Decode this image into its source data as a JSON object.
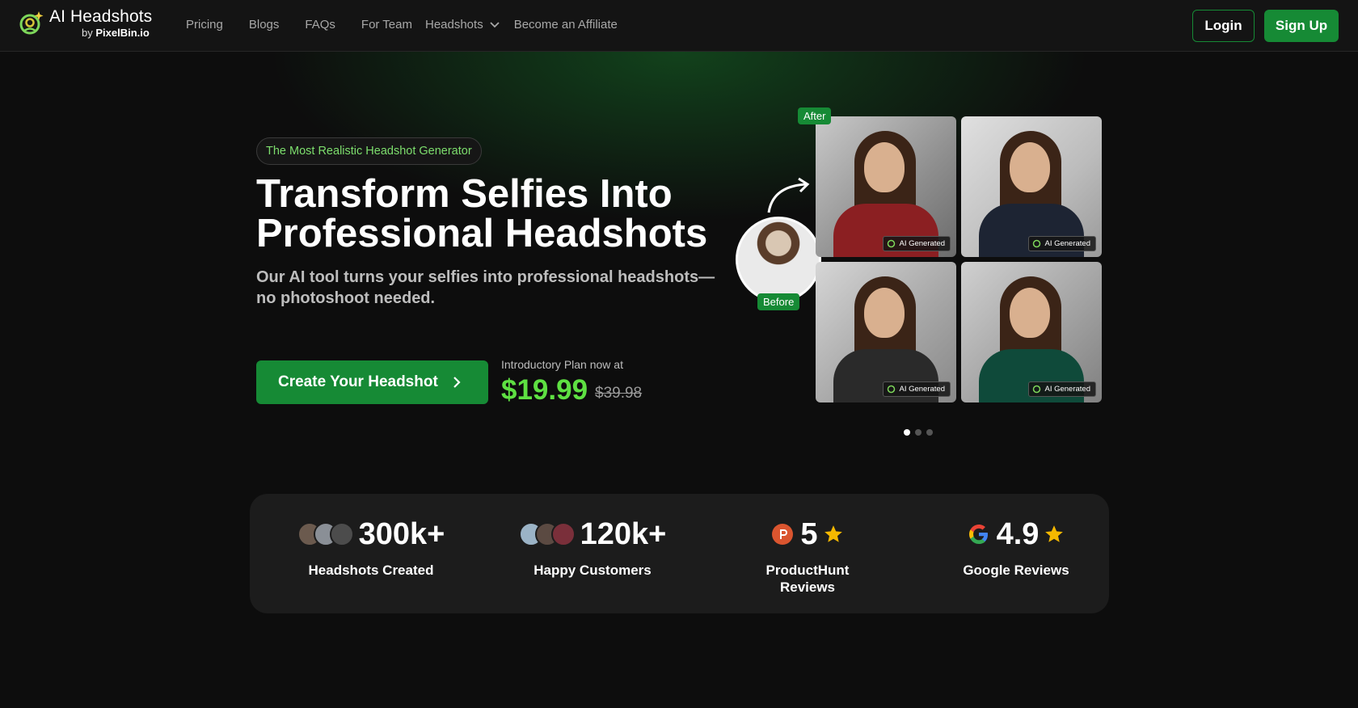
{
  "nav": {
    "logo_title": "AI Headshots",
    "logo_by": "by",
    "logo_brand": "PixelBin.io",
    "links": [
      "Pricing",
      "Blogs",
      "FAQs",
      "For Team"
    ],
    "headshots_label": "Headshots",
    "affiliate_label": "Become an Affiliate",
    "login_label": "Login",
    "signup_label": "Sign Up"
  },
  "hero": {
    "badge": "The Most Realistic Headshot Generator",
    "title_line1": "Transform Selfies Into",
    "title_line2": "Professional Headshots",
    "subtitle": "Our AI tool turns your selfies into professional headshots—no photoshoot needed.",
    "cta_label": "Create Your Headshot",
    "intro_text": "Introductory Plan now at",
    "price": "$19.99",
    "old_price": "$39.98"
  },
  "gallery": {
    "after_label": "After",
    "before_label": "Before",
    "ai_tag": "AI Generated",
    "carousel_pages": 3,
    "active_page": 1
  },
  "stats": [
    {
      "value": "300k+",
      "label": "Headshots Created"
    },
    {
      "value": "120k+",
      "label": "Happy Customers"
    },
    {
      "value": "5",
      "label_line1": "ProductHunt",
      "label_line2": "Reviews"
    },
    {
      "value": "4.9",
      "label": "Google Reviews"
    }
  ],
  "colors": {
    "brand_green": "#168a35",
    "price_green": "#5ee042",
    "badge_text": "#7dde6d",
    "star": "#f5b800"
  }
}
